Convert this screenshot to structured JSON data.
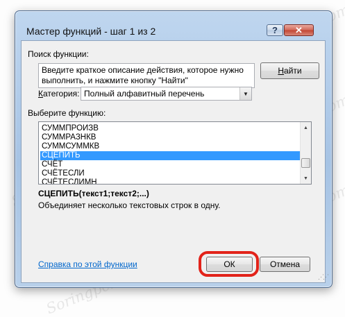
{
  "window": {
    "title": "Мастер функций - шаг 1 из 2",
    "help_glyph": "?",
    "close_glyph": "✕"
  },
  "search": {
    "label": "Поиск функции:",
    "description_text": "Введите краткое описание действия, которое нужно выполнить, и нажмите кнопку \"Найти\"",
    "find_button_accesskey": "Н",
    "find_button_rest": "айти"
  },
  "category": {
    "label_accesskey": "К",
    "label_rest": "атегория:",
    "selected": "Полный алфавитный перечень"
  },
  "function_list": {
    "label": "Выберите функцию:",
    "items": [
      "СУММПРОИЗВ",
      "СУММРАЗНКВ",
      "СУММСУММКВ",
      "СЦЕПИТЬ",
      "СЧЁТ",
      "СЧЁТЕСЛИ",
      "СЧЁТЕСЛИМН"
    ],
    "selected_index": 3
  },
  "function_info": {
    "syntax": "СЦЕПИТЬ(текст1;текст2;...)",
    "description": "Объединяет несколько текстовых строк в одну."
  },
  "footer": {
    "help_link": "Справка по этой функции",
    "ok_label": "ОК",
    "cancel_label": "Отмена"
  },
  "watermark": "Soringpcrepair.com",
  "colors": {
    "selection": "#3399ff",
    "highlight_ring": "#e2231a",
    "link": "#0066cc"
  }
}
